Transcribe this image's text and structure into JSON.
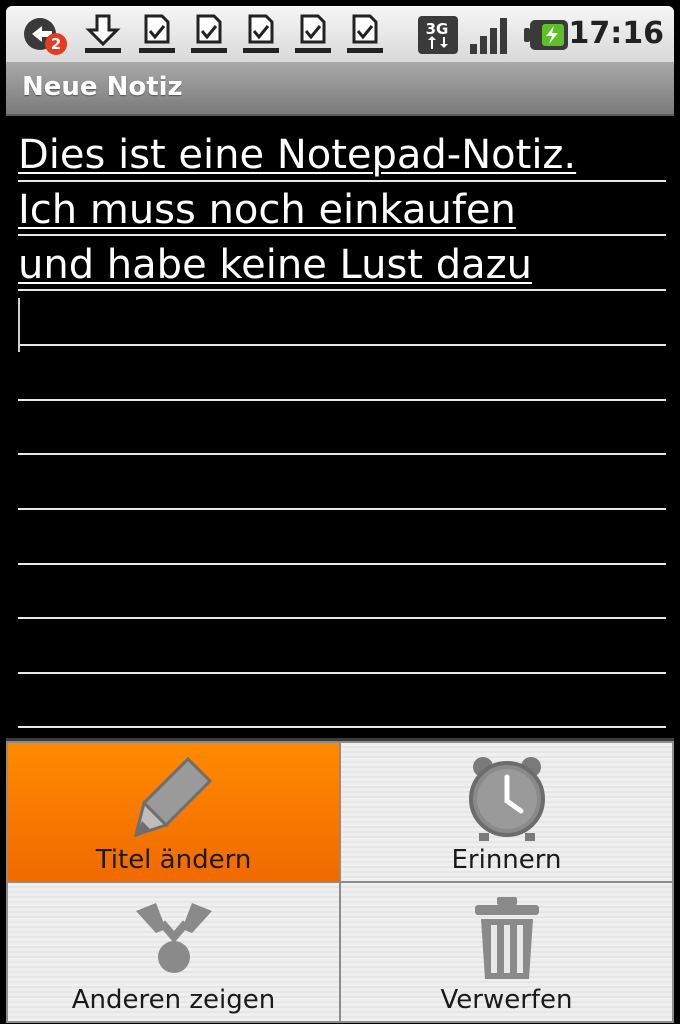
{
  "status_bar": {
    "time": "17:16",
    "notification_badge": "2",
    "network": "3G",
    "icons": [
      "app-badge-icon",
      "download-icon",
      "download-complete-icon",
      "download-complete-icon",
      "download-complete-icon",
      "download-complete-icon",
      "download-complete-icon",
      "network-3g-icon",
      "signal-icon",
      "battery-icon"
    ]
  },
  "title_bar": {
    "title": "Neue Notiz"
  },
  "note": {
    "lines": [
      "Dies ist eine Notepad-Notiz.",
      "Ich muss noch einkaufen",
      "und habe keine Lust dazu"
    ]
  },
  "menu": {
    "items": [
      {
        "label": "Titel ändern",
        "icon": "pencil-icon",
        "selected": true
      },
      {
        "label": "Erinnern",
        "icon": "alarm-clock-icon",
        "selected": false
      },
      {
        "label": "Anderen zeigen",
        "icon": "share-icon",
        "selected": false
      },
      {
        "label": "Verwerfen",
        "icon": "trash-icon",
        "selected": false
      }
    ]
  },
  "colors": {
    "selected_accent": "#ff8000",
    "background": "#000000",
    "title_bar": "#8f8f8f"
  }
}
